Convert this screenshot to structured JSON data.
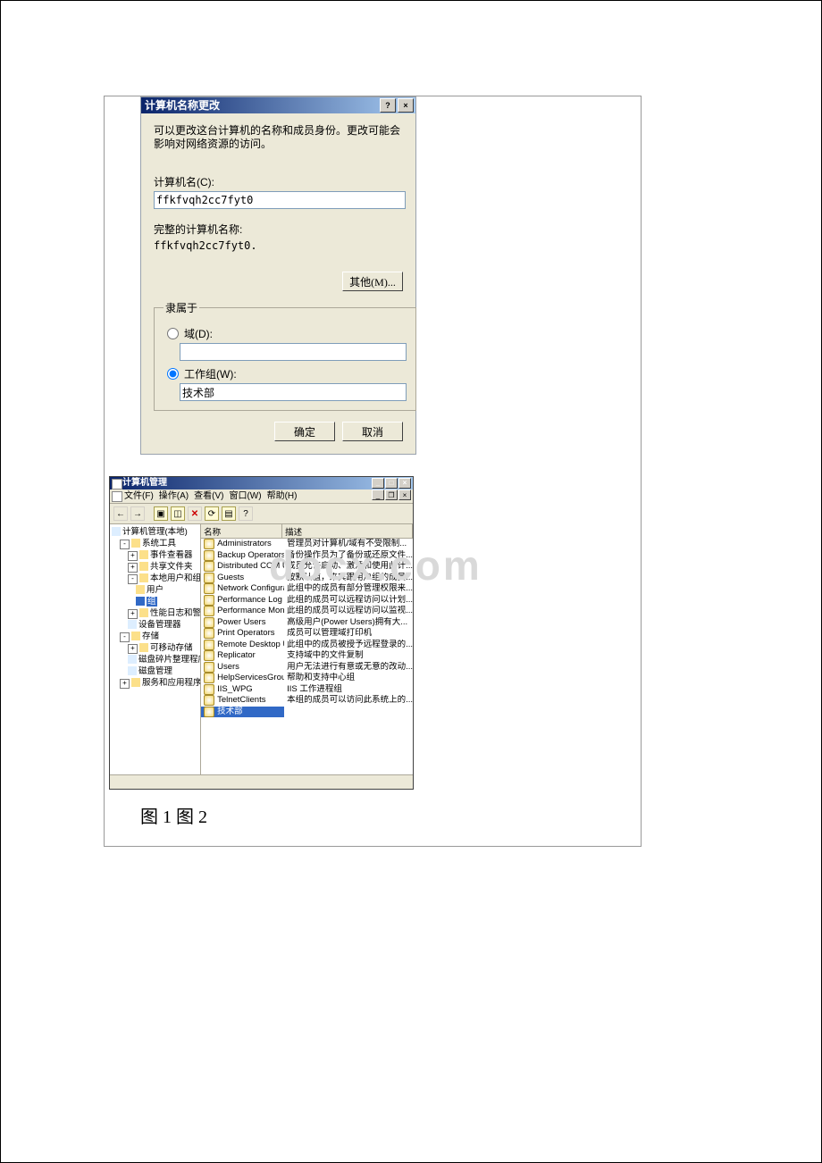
{
  "watermark": "docx.com",
  "dialog": {
    "title": "计算机名称更改",
    "help": "?",
    "close": "×",
    "message": "可以更改这台计算机的名称和成员身份。更改可能会影响对网络资源的访问。",
    "computer_name_label": "计算机名(C):",
    "computer_name_value": "ffkfvqh2cc7fyt0",
    "full_name_label": "完整的计算机名称:",
    "full_name_value": "ffkfvqh2cc7fyt0.",
    "other_button": "其他(M)...",
    "member_legend": "隶属于",
    "domain_radio": "域(D):",
    "domain_value": "",
    "workgroup_radio": "工作组(W):",
    "workgroup_value": "技术部",
    "ok": "确定",
    "cancel": "取消"
  },
  "mmc": {
    "title": "计算机管理",
    "menu": {
      "file": "文件(F)",
      "action": "操作(A)",
      "view": "查看(V)",
      "window": "窗口(W)",
      "help": "帮助(H)"
    },
    "toolbar_arrows": {
      "back": "←",
      "fwd": "→"
    },
    "cols": {
      "name": "名称",
      "desc": "描述"
    },
    "tree": {
      "root": "计算机管理(本地)",
      "sys": "系统工具",
      "event": "事件查看器",
      "shared": "共享文件夹",
      "localug": "本地用户和组",
      "users": "用户",
      "groups": "组",
      "perf": "性能日志和警报",
      "devmgr": "设备管理器",
      "storage": "存储",
      "removable": "可移动存储",
      "defrag": "磁盘碎片整理程序",
      "diskmgr": "磁盘管理",
      "services": "服务和应用程序"
    },
    "rows": [
      {
        "name": "Administrators",
        "desc": "管理员对计算机/域有不受限制..."
      },
      {
        "name": "Backup Operators",
        "desc": "备份操作员为了备份或还原文件..."
      },
      {
        "name": "Distributed COM Users",
        "desc": "成员允许启动、激活和使用此计..."
      },
      {
        "name": "Guests",
        "desc": "按默认值，来宾跟用户组的成员..."
      },
      {
        "name": "Network Configurat...",
        "desc": "此组中的成员有部分管理权限来..."
      },
      {
        "name": "Performance Log Users",
        "desc": "此组的成员可以远程访问以计划..."
      },
      {
        "name": "Performance Monito...",
        "desc": "此组的成员可以远程访问以监视..."
      },
      {
        "name": "Power Users",
        "desc": "高级用户(Power Users)拥有大..."
      },
      {
        "name": "Print Operators",
        "desc": "成员可以管理域打印机"
      },
      {
        "name": "Remote Desktop Users",
        "desc": "此组中的成员被授予远程登录的..."
      },
      {
        "name": "Replicator",
        "desc": "支持域中的文件复制"
      },
      {
        "name": "Users",
        "desc": "用户无法进行有意或无意的改动..."
      },
      {
        "name": "HelpServicesGroup",
        "desc": "帮助和支持中心组"
      },
      {
        "name": "IIS_WPG",
        "desc": "IIS 工作进程组"
      },
      {
        "name": "TelnetClients",
        "desc": "本组的成员可以访问此系统上的..."
      },
      {
        "name": "技术部",
        "desc": ""
      }
    ]
  },
  "caption": "图 1 图 2"
}
